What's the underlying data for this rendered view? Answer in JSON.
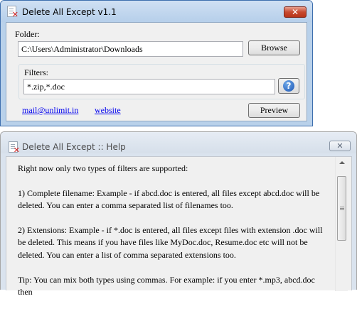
{
  "main_window": {
    "title": "Delete All Except v1.1",
    "close_glyph": "✕",
    "folder_label": "Folder:",
    "folder_value": "C:\\Users\\Administrator\\Downloads",
    "browse_label": "Browse",
    "filters_label": "Filters:",
    "filters_value": "*.zip,*.doc",
    "help_icon": "help-question-icon",
    "help_glyph": "?",
    "email_link": "mail@unlimit.in",
    "website_link": "website",
    "preview_label": "Preview"
  },
  "help_window": {
    "title": "Delete All Except :: Help",
    "close_glyph": "✕",
    "paragraphs": [
      "Right now only two types of filters are supported:",
      "1) Complete filename: Example - if abcd.doc is entered, all files except abcd.doc will be deleted. You can enter a comma separated list of filenames too.",
      "2) Extensions: Example - if *.doc is entered, all files except files with extension .doc will be deleted. This means if you have files like MyDoc.doc, Resume.doc etc will not be deleted. You can enter a list of comma separated extensions too.",
      "Tip: You can mix both types using commas. For example: if you enter *.mp3, abcd.doc then"
    ]
  },
  "colors": {
    "active_frame": "#b9d1ea",
    "inactive_frame": "#dae3ee",
    "close_red": "#c74a30",
    "link_blue": "#0000ee",
    "help_blue": "#1b56b5"
  }
}
